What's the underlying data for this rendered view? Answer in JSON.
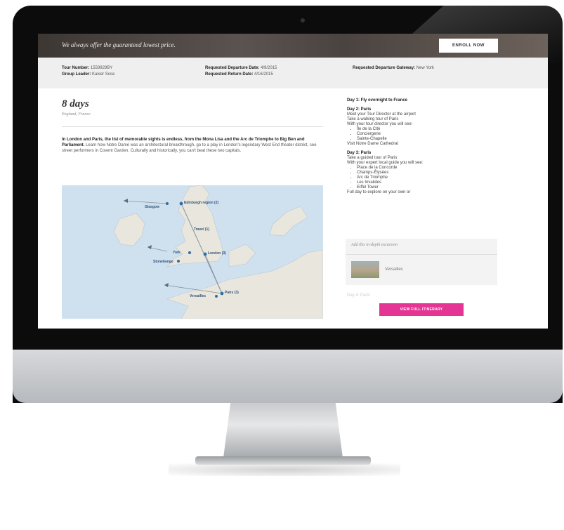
{
  "banner": {
    "tagline": "We always offer the guaranteed lowest price.",
    "enroll_label": "ENROLL NOW"
  },
  "trip_info": {
    "tour_number_label": "Tour Number:",
    "tour_number_value": "1559929BY",
    "group_leader_label": "Group Leader:",
    "group_leader_value": "Kaiser Sose",
    "departure_date_label": "Requested Departure Date:",
    "departure_date_value": "4/9/2015",
    "return_date_label": "Requested Return Date:",
    "return_date_value": "4/16/2015",
    "gateway_label": "Requested Departure Gateway:",
    "gateway_value": "New York"
  },
  "overview": {
    "duration": "8 days",
    "countries": "England, France",
    "intro_bold": "In London and Paris, the list of memorable sights is endless, from the Mona Lisa and the Arc de Triomphe to Big Ben and Parliament.",
    "intro_rest": " Learn how Notre Dame was an architectural breakthrough, go to a play in London's legendary West End theater district, see street performers in Covent Garden. Culturally and historically, you can't beat these two capitals."
  },
  "map": {
    "labels": [
      "Edinburgh region (2)",
      "Glasgow",
      "Travel (1)",
      "York",
      "London (3)",
      "Stonehenge",
      "Paris (3)",
      "Versailles"
    ]
  },
  "itinerary": {
    "day1_title": "Day 1: Fly overnight to France",
    "day2_title": "Day 2: Paris",
    "day2_lines": [
      "Meet your Tour Director at the airport",
      "Take a walking tour of Paris",
      "With your tour director you will see:"
    ],
    "day2_sights": [
      "Île de la Cité",
      "Conciergerie",
      "Sainte-Chapelle"
    ],
    "day2_after": "Visit Notre Dame Cathedral",
    "day3_title": "Day 3: Paris",
    "day3_lines": [
      "Take a guided tour of Paris",
      "With your expert local guide you will see:"
    ],
    "day3_sights": [
      "Place de la Concorde",
      "Champs-Élysées",
      "Arc de Triomphe",
      "Les Invalides",
      "Eiffel Tower"
    ],
    "day3_after": "Full day to explore on your own or"
  },
  "excursion": {
    "title": "Add this in-depth excursion",
    "item": "Versailles"
  },
  "faded_next": "Day 4: Paris",
  "cta_label": "VIEW FULL ITINERARY"
}
